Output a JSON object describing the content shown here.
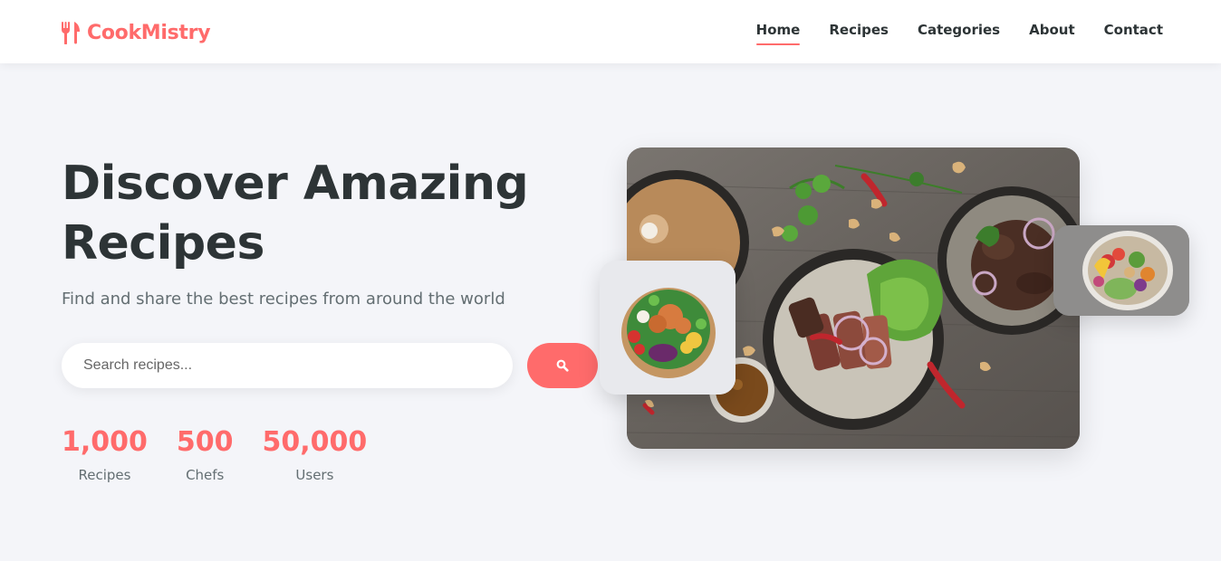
{
  "brand": {
    "name": "CookMistry",
    "icon": "utensils-icon",
    "accent_color": "#ff6b6b"
  },
  "nav": {
    "items": [
      {
        "label": "Home",
        "active": true
      },
      {
        "label": "Recipes",
        "active": false
      },
      {
        "label": "Categories",
        "active": false
      },
      {
        "label": "About",
        "active": false
      },
      {
        "label": "Contact",
        "active": false
      }
    ]
  },
  "hero": {
    "title": "Discover Amazing Recipes",
    "subtitle": "Find and share the best recipes from around the world",
    "search": {
      "placeholder": "Search recipes...",
      "value": "",
      "button_icon": "search-icon"
    },
    "stats": [
      {
        "value": "1,000",
        "label": "Recipes"
      },
      {
        "value": "500",
        "label": "Chefs"
      },
      {
        "value": "50,000",
        "label": "Users"
      }
    ]
  },
  "images": {
    "main": "food-platter-image",
    "card_left": "salad-bowl-image",
    "card_right": "buddha-bowl-image"
  }
}
